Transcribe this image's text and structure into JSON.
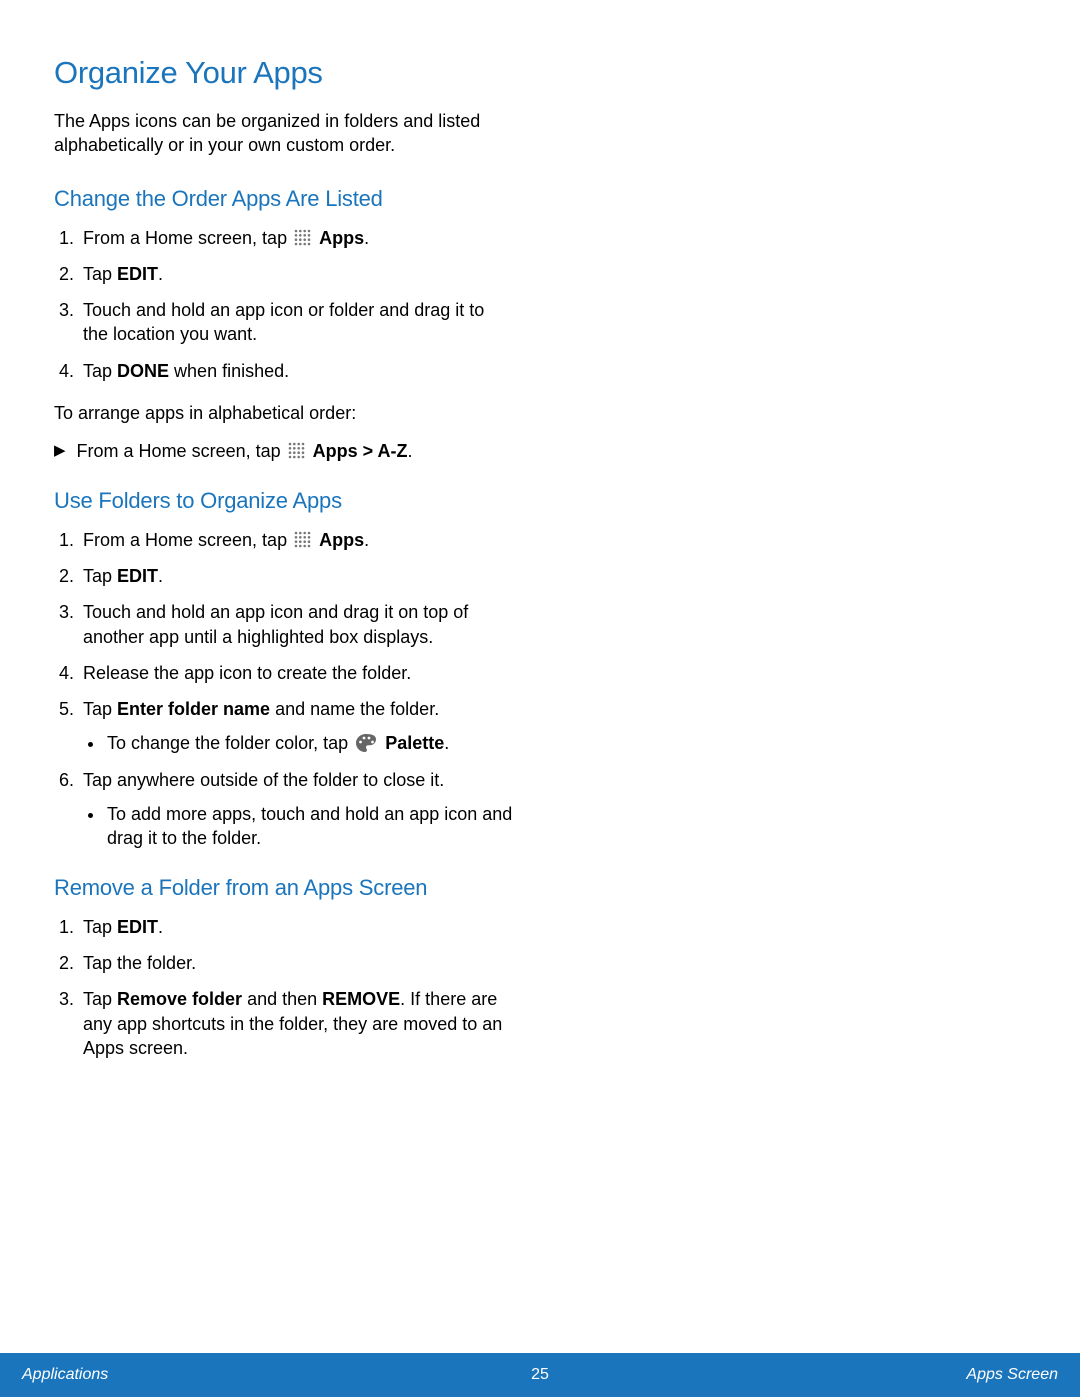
{
  "title": "Organize Your Apps",
  "intro": "The Apps icons can be organized in folders and listed alphabetically or in your own custom order.",
  "section1": {
    "heading": "Change the Order Apps Are Listed",
    "steps": {
      "s1_pre": "From a Home screen, tap",
      "s1_bold": "Apps",
      "s2_pre": "Tap ",
      "s2_bold": "EDIT",
      "s3": "Touch and hold an app icon or folder and drag it to the location you want.",
      "s4_pre": "Tap ",
      "s4_bold": "DONE",
      "s4_post": " when finished."
    },
    "arrange": "To arrange apps in alphabetical order:",
    "arrow_pre": "From a Home screen, tap",
    "arrow_bold": "Apps > A-Z"
  },
  "section2": {
    "heading": "Use Folders to Organize Apps",
    "steps": {
      "s1_pre": "From a Home screen, tap",
      "s1_bold": "Apps",
      "s2_pre": "Tap ",
      "s2_bold": "EDIT",
      "s3": "Touch and hold an app icon and drag it on top of another app until a highlighted box displays.",
      "s4": "Release the app icon to create the folder.",
      "s5_pre": "Tap ",
      "s5_bold": "Enter folder name",
      "s5_post": " and name the folder.",
      "s5_sub_pre": "To change the folder color, tap",
      "s5_sub_bold": "Palette",
      "s6": "Tap anywhere outside of the folder to close it.",
      "s6_sub": "To add more apps, touch and hold an app icon and drag it to the folder."
    }
  },
  "section3": {
    "heading": "Remove a Folder from an Apps Screen",
    "steps": {
      "s1_pre": "Tap ",
      "s1_bold": "EDIT",
      "s2": "Tap the folder.",
      "s3_pre": "Tap ",
      "s3_bold1": "Remove folder",
      "s3_mid": " and then ",
      "s3_bold2": "REMOVE",
      "s3_post": ". If there are any app shortcuts in the folder, they are moved to an Apps screen."
    }
  },
  "footer": {
    "left": "Applications",
    "center": "25",
    "right": "Apps Screen"
  }
}
